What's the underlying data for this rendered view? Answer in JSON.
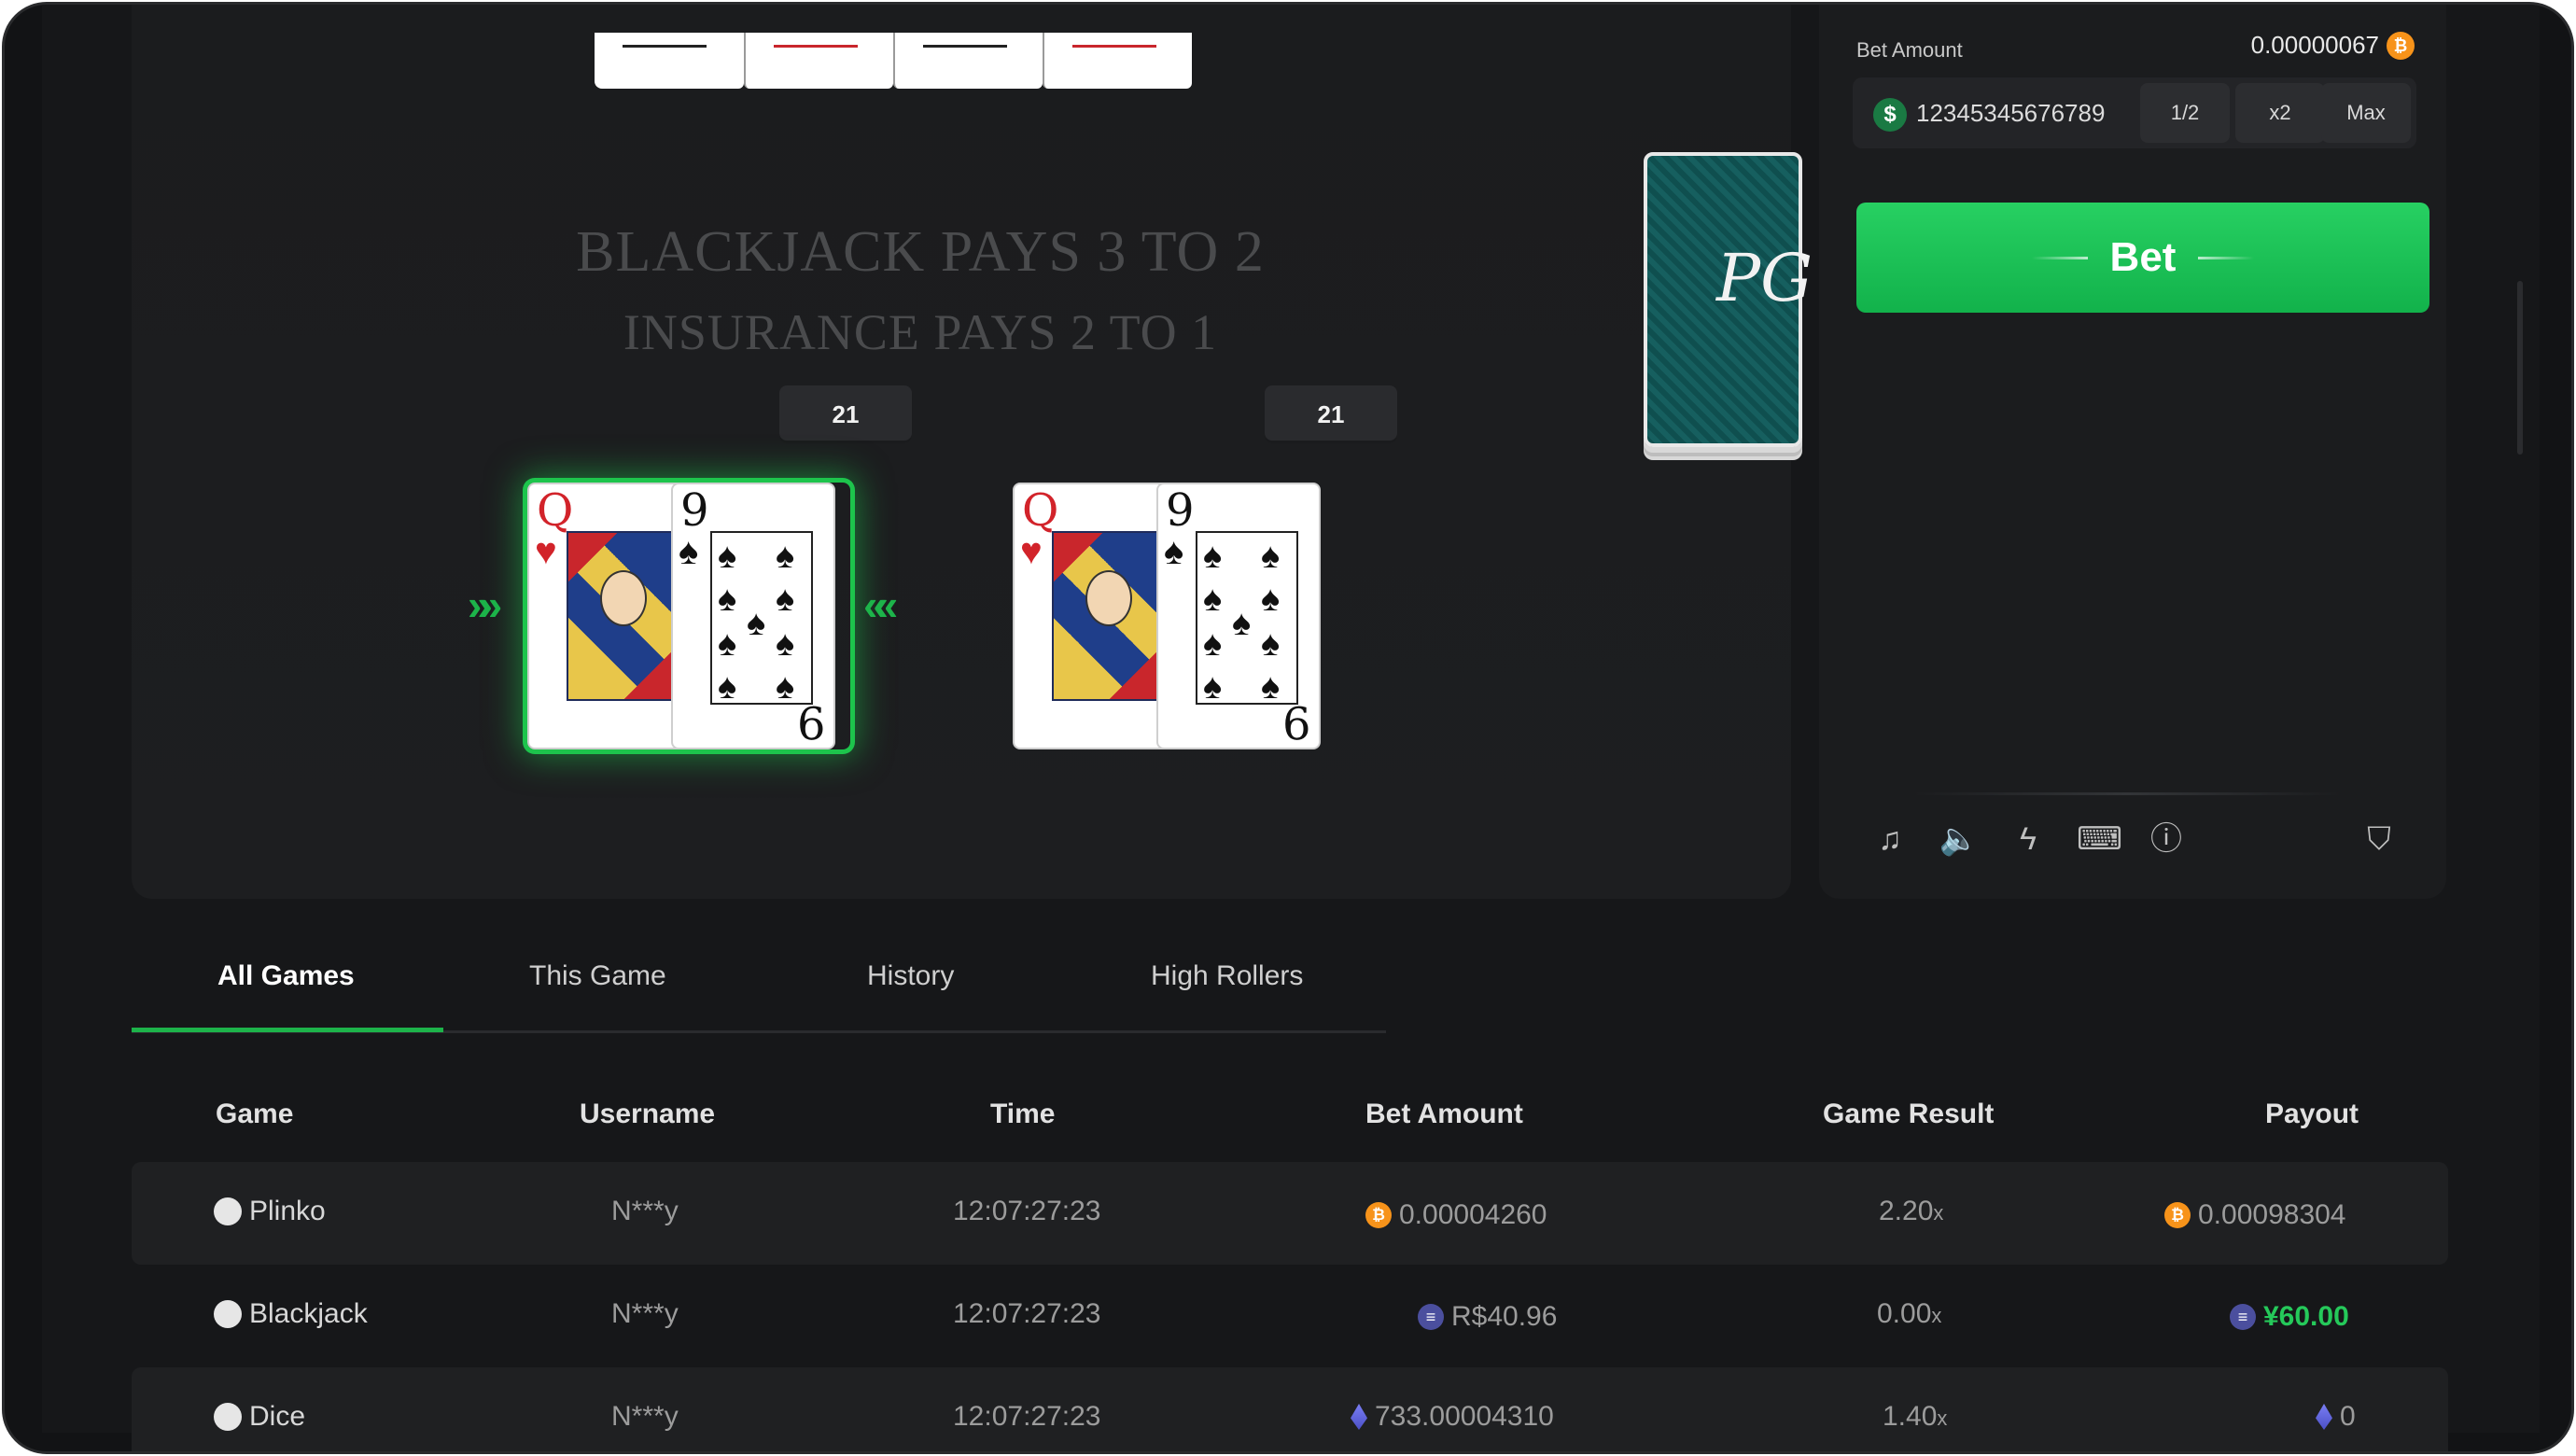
{
  "board": {
    "pays_line1": "BLACKJACK PAYS 3 TO 2",
    "pays_line2": "INSURANCE PAYS 2 TO 1",
    "hands": [
      {
        "score": "21",
        "cards": [
          {
            "rank": "Q",
            "suit": "♥"
          },
          {
            "rank": "9",
            "suit": "♠"
          }
        ]
      },
      {
        "score": "21",
        "cards": [
          {
            "rank": "Q",
            "suit": "♥"
          },
          {
            "rank": "9",
            "suit": "♠"
          }
        ]
      }
    ],
    "deck_logo": "PG"
  },
  "panel": {
    "bet_amount_label": "Bet Amount",
    "bet_amount_value": "0.00000067",
    "amount_input_value": "12345345676789",
    "half_label": "1/2",
    "double_label": "x2",
    "max_label": "Max",
    "bet_button_label": "Bet",
    "tools": [
      "music-off-icon",
      "sound-icon",
      "lightning-icon",
      "keyboard-icon",
      "info-icon",
      "shield-check-icon"
    ]
  },
  "tabs": [
    {
      "label": "All Games",
      "active": true
    },
    {
      "label": "This Game",
      "active": false
    },
    {
      "label": "History",
      "active": false
    },
    {
      "label": "High Rollers",
      "active": false
    }
  ],
  "table": {
    "headers": [
      "Game",
      "Username",
      "Time",
      "Bet Amount",
      "Game Result",
      "Payout"
    ],
    "rows": [
      {
        "game": "Plinko",
        "username": "N***y",
        "time": "12:07:27:23",
        "bet_currency": "btc",
        "bet": "0.00004260",
        "result": "2.20",
        "result_suffix": "x",
        "payout_currency": "btc",
        "payout": "0.00098304",
        "payout_win": false
      },
      {
        "game": "Blackjack",
        "username": "N***y",
        "time": "12:07:27:23",
        "bet_currency": "real",
        "bet": "R$40.96",
        "result": "0.00",
        "result_suffix": "x",
        "payout_currency": "real",
        "payout": "¥60.00",
        "payout_win": true
      },
      {
        "game": "Dice",
        "username": "N***y",
        "time": "12:07:27:23",
        "bet_currency": "eth",
        "bet": "733.00004310",
        "result": "1.40",
        "result_suffix": "x",
        "payout_currency": "eth",
        "payout": "0",
        "payout_win": false
      }
    ]
  },
  "colors": {
    "accent": "#1db34a",
    "background": "#121315",
    "bitcoin": "#f7931a"
  }
}
